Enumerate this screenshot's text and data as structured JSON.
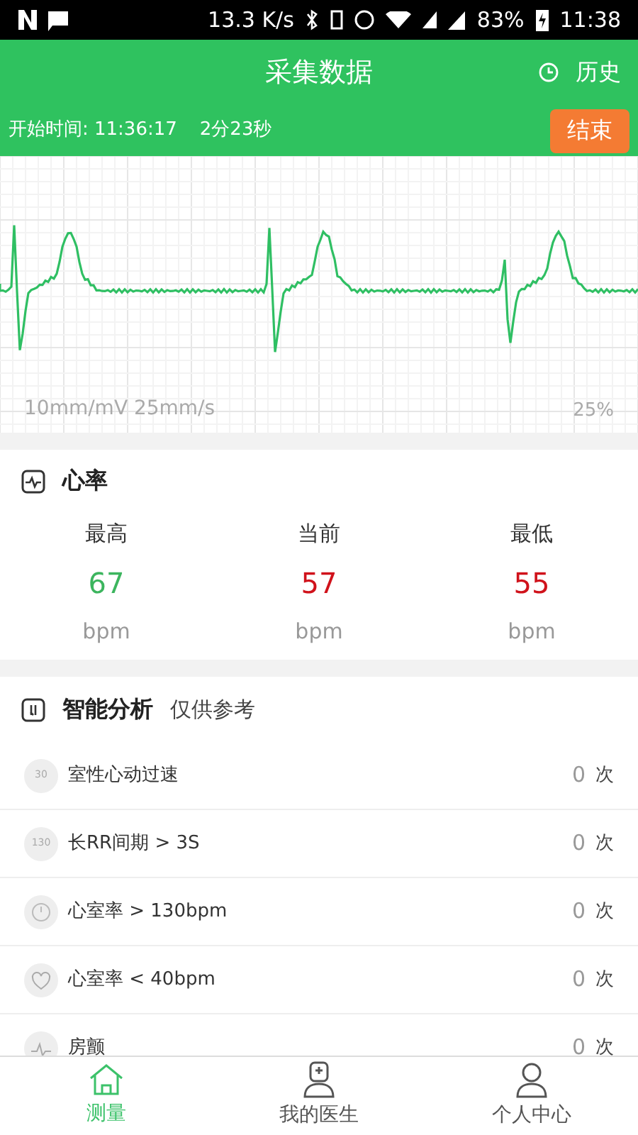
{
  "status_bar": {
    "network_speed": "13.3 K/s",
    "battery": "83%",
    "time": "11:38"
  },
  "header": {
    "title": "采集数据",
    "history_button": "历史"
  },
  "session": {
    "start_time": "开始时间: 11:36:17",
    "duration": "2分23秒",
    "end_button": "结束"
  },
  "ecg": {
    "scale": "10mm/mV 25mm/s",
    "zoom": "25%"
  },
  "heart_rate": {
    "title": "心率",
    "stats": [
      {
        "label": "最高",
        "value": "67",
        "unit": "bpm",
        "color": "#3cb55e"
      },
      {
        "label": "当前",
        "value": "57",
        "unit": "bpm",
        "color": "#d0121b"
      },
      {
        "label": "最低",
        "value": "55",
        "unit": "bpm",
        "color": "#d0121b"
      }
    ]
  },
  "analysis": {
    "title": "智能分析",
    "subtitle": "仅供参考",
    "rows": [
      {
        "kind": "badge",
        "badge": "30",
        "name": "室性心动过速",
        "count": "0",
        "unit": "次"
      },
      {
        "kind": "badge",
        "badge": "130",
        "name": "长RR间期 > 3S",
        "count": "0",
        "unit": "次"
      },
      {
        "kind": "clock",
        "name": "心室率 > 130bpm",
        "count": "0",
        "unit": "次"
      },
      {
        "kind": "heart",
        "name": "心室率 < 40bpm",
        "count": "0",
        "unit": "次"
      },
      {
        "kind": "wave",
        "name": "房颤",
        "count": "0",
        "unit": "次"
      }
    ]
  },
  "tabs": [
    {
      "kind": "home",
      "label": "测量",
      "selected": true
    },
    {
      "kind": "doctor",
      "label": "我的医生",
      "selected": false
    },
    {
      "kind": "person",
      "label": "个人中心",
      "selected": false
    }
  ]
}
